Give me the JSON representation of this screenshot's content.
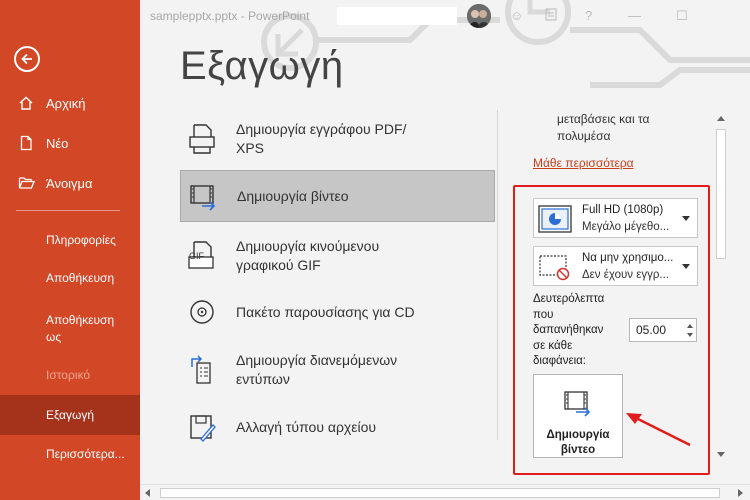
{
  "titlebar": {
    "title": "samplepptx.pptx  -  PowerPoint",
    "help": "?",
    "minimize": "—",
    "maximize": "☐"
  },
  "sidebar": {
    "items": [
      {
        "label": "Αρχική"
      },
      {
        "label": "Νέο"
      },
      {
        "label": "Άνοιγμα"
      }
    ],
    "sub_items": [
      {
        "label": "Πληροφορίες"
      },
      {
        "label": "Αποθήκευση"
      },
      {
        "label": "Αποθήκευση"
      },
      {
        "label": "ως"
      },
      {
        "label": "Ιστορικό"
      },
      {
        "label": "Εξαγωγή"
      },
      {
        "label": "Περισσότερα..."
      }
    ]
  },
  "main": {
    "title": "Εξαγωγή",
    "options": [
      {
        "line1": "Δημιουργία εγγράφου PDF/",
        "line2": "XPS"
      },
      {
        "line1": "Δημιουργία βίντεο",
        "line2": ""
      },
      {
        "line1": "Δημιουργία κινούμενου",
        "line2": "γραφικού GIF"
      },
      {
        "line1": "Πακέτο παρουσίασης για CD",
        "line2": ""
      },
      {
        "line1": "Δημιουργία διανεμόμενων",
        "line2": "εντύπων"
      },
      {
        "line1": "Αλλαγή τύπου αρχείου",
        "line2": ""
      }
    ],
    "gif_badge": "GIF"
  },
  "panel": {
    "text_line1": "μεταβάσεις και τα",
    "text_line2": "πολυμέσα",
    "learn_more": "Μάθε περισσότερα",
    "quality": {
      "line1": "Full HD (1080p)",
      "line2": "Μεγάλο μέγεθο..."
    },
    "timings": {
      "line1": "Να μην χρησιμο...",
      "line2": "Δεν έχουν εγγρ..."
    },
    "seconds_label": [
      "Δευτερόλεπτα",
      "που",
      "δαπανήθηκαν",
      "σε κάθε",
      "διαφάνεια:"
    ],
    "seconds_value": "05.00",
    "create_button": {
      "line1": "Δημιουργία",
      "line2": "βίντεο"
    }
  },
  "colors": {
    "accent": "#d24726",
    "active": "#a5321b",
    "highlight_box": "#e21c1c",
    "link": "#c43e1c"
  }
}
